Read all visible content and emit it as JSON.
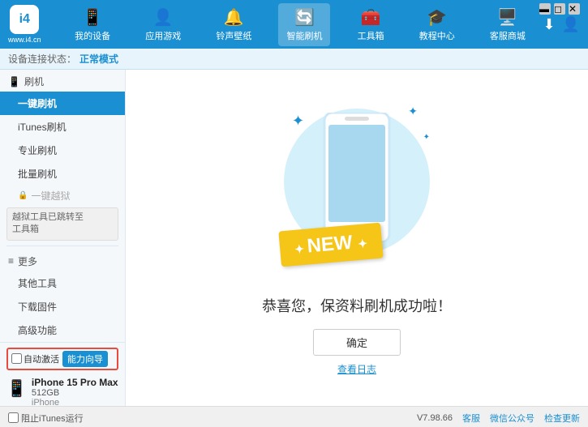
{
  "app": {
    "logo_text": "www.i4.cn",
    "logo_icon": "i4"
  },
  "window_controls": {
    "minimize": "—",
    "maximize": "□",
    "close": "✕"
  },
  "nav": {
    "items": [
      {
        "id": "my-device",
        "label": "我的设备",
        "icon": "📱"
      },
      {
        "id": "apps-games",
        "label": "应用游戏",
        "icon": "👤"
      },
      {
        "id": "ringtones",
        "label": "铃声壁纸",
        "icon": "🔔"
      },
      {
        "id": "smart-flash",
        "label": "智能刷机",
        "icon": "🔄",
        "active": true
      },
      {
        "id": "toolbox",
        "label": "工具箱",
        "icon": "🧰"
      },
      {
        "id": "tutorials",
        "label": "教程中心",
        "icon": "🎓"
      },
      {
        "id": "service",
        "label": "客服商城",
        "icon": "🖥️"
      }
    ],
    "download_icon": "⬇",
    "user_icon": "👤"
  },
  "status_bar": {
    "label": "设备连接状态：",
    "value": "正常模式"
  },
  "sidebar": {
    "flash_section": {
      "header": "刷机",
      "header_icon": "📱",
      "items": [
        {
          "id": "one-key-flash",
          "label": "一键刷机",
          "active": true
        },
        {
          "id": "itunes-flash",
          "label": "iTunes刷机",
          "active": false
        },
        {
          "id": "pro-flash",
          "label": "专业刷机",
          "active": false
        },
        {
          "id": "batch-flash",
          "label": "批量刷机",
          "active": false
        }
      ],
      "disabled_item": "一键越狱",
      "note_line1": "越狱工具已跳转至",
      "note_line2": "工具箱"
    },
    "more_section": {
      "header": "更多",
      "items": [
        {
          "id": "other-tools",
          "label": "其他工具"
        },
        {
          "id": "download-firmware",
          "label": "下载固件"
        },
        {
          "id": "advanced",
          "label": "高级功能"
        }
      ]
    }
  },
  "sidebar_bottom": {
    "auto_activate_label": "自动激活",
    "guided_tour_label": "能力向导",
    "device_name": "iPhone 15 Pro Max",
    "device_storage": "512GB",
    "device_type": "iPhone"
  },
  "content": {
    "new_badge": "NEW",
    "success_message": "恭喜您，保资料刷机成功啦！",
    "confirm_button": "确定",
    "view_log": "查看日志"
  },
  "bottom_bar": {
    "itunes_label": "阻止iTunes运行",
    "version": "V7.98.66",
    "desktop_label": "客服",
    "wechat_label": "微信公众号",
    "check_update_label": "检查更新"
  }
}
